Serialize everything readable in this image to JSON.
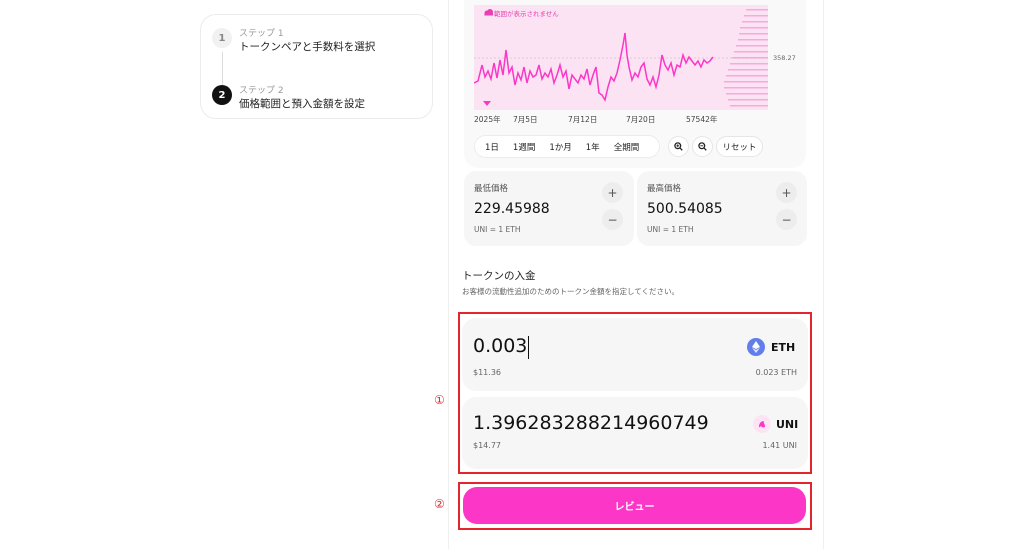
{
  "stepper": {
    "step1": {
      "num": "1",
      "kicker": "ステップ 1",
      "title": "トークンペアと手数料を選択"
    },
    "step2": {
      "num": "2",
      "kicker": "ステップ 2",
      "title": "価格範囲と預入金額を設定"
    }
  },
  "chart": {
    "range_notice": "範囲が表示されません",
    "price_tag": "358.27",
    "x_ticks": [
      "2025年",
      "7月5日",
      "7月12日",
      "7月20日",
      "57542年"
    ],
    "line_color": "#fc37c8",
    "area_color": "#fbe3f3"
  },
  "time_buttons": {
    "d1": "1日",
    "w1": "1週間",
    "m1": "1か月",
    "y1": "1年",
    "all": "全期間"
  },
  "reset_label": "リセット",
  "min_price": {
    "label": "最低価格",
    "value": "229.45988",
    "unit": "UNI = 1 ETH"
  },
  "max_price": {
    "label": "最高価格",
    "value": "500.54085",
    "unit": "UNI = 1 ETH"
  },
  "deposit": {
    "title": "トークンの入金",
    "subtitle": "お客様の流動性追加のためのトークン金額を指定してください。",
    "eth": {
      "amount": "0.003",
      "usd": "$11.36",
      "symbol": "ETH",
      "balance": "0.023 ETH"
    },
    "uni": {
      "amount": "1.396283288214960749",
      "usd": "$14.77",
      "symbol": "UNI",
      "balance": "1.41 UNI"
    }
  },
  "annotations": {
    "one": "①",
    "two": "②"
  },
  "review_label": "レビュー",
  "colors": {
    "accent": "#fc37c8",
    "eth_icon": "#627eea",
    "highlight": "#e3262e"
  }
}
